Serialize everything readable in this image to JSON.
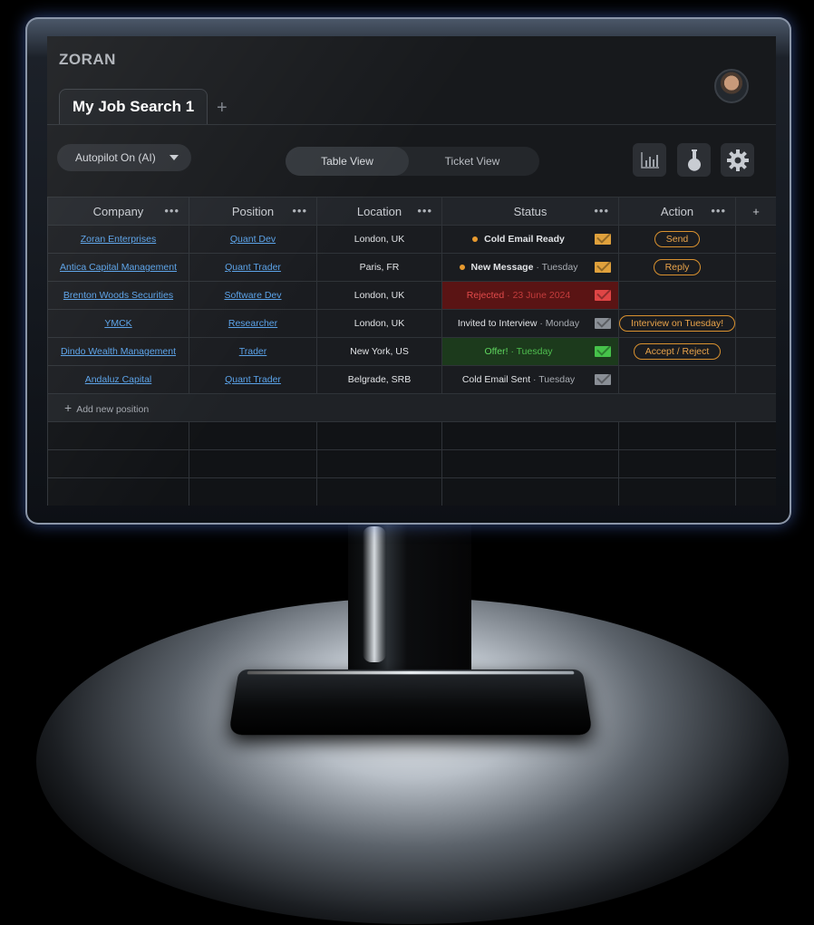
{
  "app": {
    "brand": "ZORAN"
  },
  "tabs": [
    {
      "label": "My Job Search 1"
    }
  ],
  "tab_add": "+",
  "toolbar": {
    "autopilot_label": "Autopilot On (AI)",
    "views": [
      {
        "label": "Table View",
        "active": true
      },
      {
        "label": "Ticket View",
        "active": false
      }
    ],
    "icons": [
      "bar-chart-icon",
      "flask-icon",
      "gear-icon"
    ]
  },
  "table": {
    "columns": [
      "Company",
      "Position",
      "Location",
      "Status",
      "Action"
    ],
    "column_menu": "•••",
    "add_column": "+",
    "rows": [
      {
        "company": "Zoran Enterprises",
        "position": "Quant Dev",
        "location": "London, UK",
        "status": "Cold Email Ready",
        "status_day": "",
        "status_kind": "pending",
        "mail_color": "#e0a13c",
        "action": "Send"
      },
      {
        "company": "Antica Capital Management",
        "position": "Quant Trader",
        "location": "Paris, FR",
        "status": "New Message",
        "status_day": "· Tuesday",
        "status_kind": "pending",
        "mail_color": "#e0a13c",
        "action": "Reply"
      },
      {
        "company": "Brenton Woods Securities",
        "position": "Software Dev",
        "location": "London, UK",
        "status": "Rejected",
        "status_day": "· 23 June 2024",
        "status_kind": "rejected",
        "mail_color": "#e04545",
        "action": ""
      },
      {
        "company": "YMCK",
        "position": "Researcher",
        "location": "London, UK",
        "status": "Invited to Interview",
        "status_day": "· Monday",
        "status_kind": "neutral",
        "mail_color": "#8a8f96",
        "action": "Interview on Tuesday!"
      },
      {
        "company": "Dindo Wealth Management",
        "position": "Trader",
        "location": "New York, US",
        "status": "Offer!",
        "status_day": "· Tuesday",
        "status_kind": "offer",
        "mail_color": "#46c24a",
        "action": "Accept / Reject"
      },
      {
        "company": "Andaluz Capital",
        "position": "Quant Trader",
        "location": "Belgrade, SRB",
        "status": "Cold Email Sent",
        "status_day": "· Tuesday",
        "status_kind": "neutral",
        "mail_color": "#8a8f96",
        "action": ""
      }
    ],
    "add_row_label": "Add new position"
  }
}
